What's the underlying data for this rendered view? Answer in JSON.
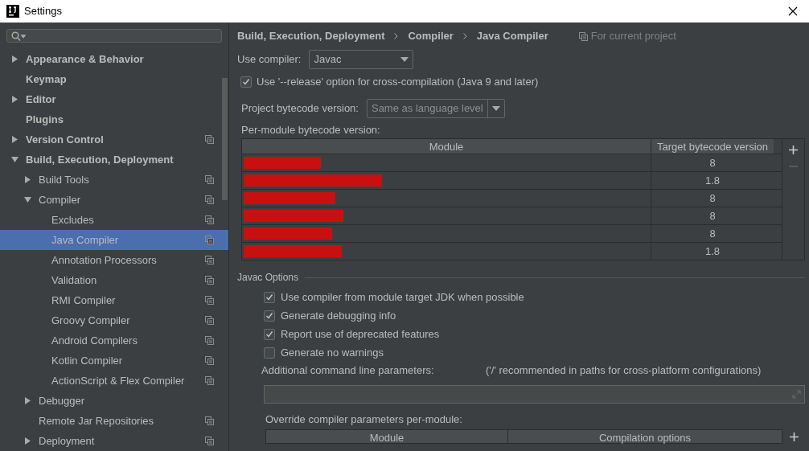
{
  "window": {
    "title": "Settings"
  },
  "sidebar": {
    "items": [
      {
        "label": "Appearance & Behavior",
        "expanded": false,
        "project_level": false,
        "selected": false
      },
      {
        "label": "Keymap",
        "project_level": false,
        "selected": false
      },
      {
        "label": "Editor",
        "expanded": false,
        "project_level": false,
        "selected": false
      },
      {
        "label": "Plugins",
        "project_level": false,
        "selected": false
      },
      {
        "label": "Version Control",
        "expanded": false,
        "project_level": true,
        "selected": false
      },
      {
        "label": "Build, Execution, Deployment",
        "expanded": true,
        "project_level": false,
        "selected": false,
        "children": [
          {
            "label": "Build Tools",
            "expanded": false,
            "project_level": true,
            "selected": false
          },
          {
            "label": "Compiler",
            "expanded": true,
            "project_level": true,
            "selected": false,
            "children": [
              {
                "label": "Excludes",
                "project_level": true,
                "selected": false
              },
              {
                "label": "Java Compiler",
                "project_level": true,
                "selected": true
              },
              {
                "label": "Annotation Processors",
                "project_level": true,
                "selected": false
              },
              {
                "label": "Validation",
                "project_level": true,
                "selected": false
              },
              {
                "label": "RMI Compiler",
                "project_level": true,
                "selected": false
              },
              {
                "label": "Groovy Compiler",
                "project_level": true,
                "selected": false
              },
              {
                "label": "Android Compilers",
                "project_level": true,
                "selected": false
              },
              {
                "label": "Kotlin Compiler",
                "project_level": true,
                "selected": false
              },
              {
                "label": "ActionScript & Flex Compiler",
                "project_level": true,
                "selected": false
              }
            ]
          },
          {
            "label": "Debugger",
            "expanded": false,
            "project_level": false,
            "selected": false
          },
          {
            "label": "Remote Jar Repositories",
            "project_level": true,
            "selected": false
          },
          {
            "label": "Deployment",
            "expanded": false,
            "project_level": true,
            "selected": false
          }
        ]
      }
    ]
  },
  "breadcrumb": [
    "Build, Execution, Deployment",
    "Compiler",
    "Java Compiler"
  ],
  "scope_note": "For current project",
  "use_compiler": {
    "label": "Use compiler:",
    "value": "Javac"
  },
  "release_option": {
    "label": "Use '--release' option for cross-compilation (Java 9 and later)",
    "checked": true
  },
  "project_bytecode": {
    "label": "Project bytecode version:",
    "value": "Same as language level"
  },
  "per_module": {
    "label": "Per-module bytecode version:",
    "columns": [
      "Module",
      "Target bytecode version"
    ],
    "rows": [
      {
        "target": "8"
      },
      {
        "target": "1.8"
      },
      {
        "target": "8"
      },
      {
        "target": "8"
      },
      {
        "target": "8"
      },
      {
        "target": "1.8"
      }
    ]
  },
  "javac_options": {
    "title": "Javac Options",
    "checkboxes": [
      {
        "label": "Use compiler from module target JDK when possible",
        "checked": true
      },
      {
        "label": "Generate debugging info",
        "checked": true
      },
      {
        "label": "Report use of deprecated features",
        "checked": true
      },
      {
        "label": "Generate no warnings",
        "checked": false
      }
    ],
    "params_label": "Additional command line parameters:",
    "params_hint": "('/' recommended in paths for cross-platform configurations)",
    "override_label": "Override compiler parameters per-module:",
    "override_columns": [
      "Module",
      "Compilation options"
    ]
  }
}
